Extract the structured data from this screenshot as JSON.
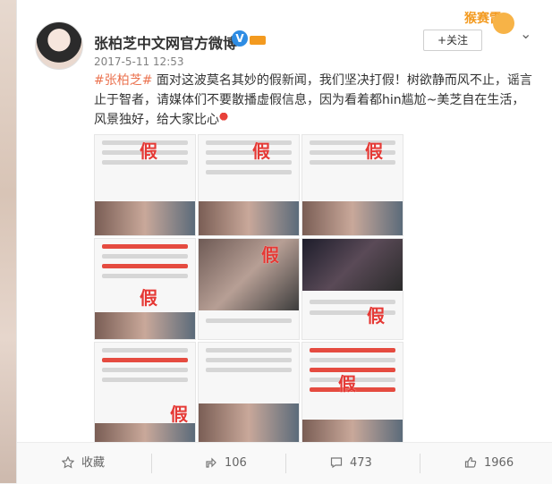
{
  "post": {
    "author": "张柏芝中文网官方微博",
    "timestamp": "2017-5-11 12:53",
    "follow_label": "+关注",
    "mascot_text": "猴赛雷",
    "hashtag": "#张柏芝#",
    "body": " 面对这波莫名其妙的假新闻，我们坚决打假！树欲静而风不止，谣言止于智者，请媒体们不要散播虚假信息，因为看着都hin尴尬~美芝自在生活，风景独好，给大家比心",
    "stamp_text": "假"
  },
  "actions": {
    "collect_label": "收藏",
    "forward_count": "106",
    "comment_count": "473",
    "like_count": "1966"
  },
  "colors": {
    "link": "#eb7350",
    "stamp": "#e53935",
    "verified": "#2e8ce3"
  }
}
